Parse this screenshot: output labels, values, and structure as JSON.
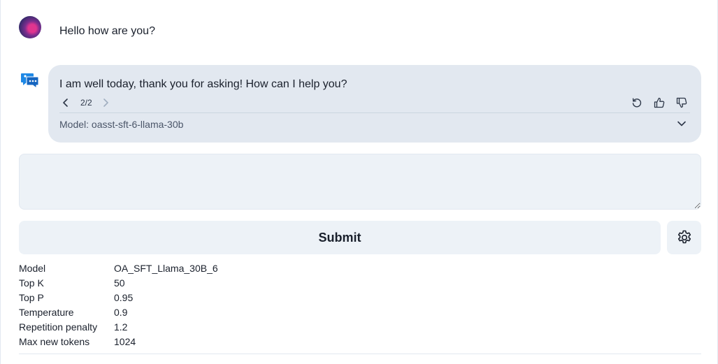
{
  "conversation": {
    "user_message": "Hello how are you?",
    "assistant_message": "I am well today, thank you for asking! How can I help you?",
    "pager": "2/2",
    "model_label": "Model: ",
    "model_value": "oasst-sft-6-llama-30b"
  },
  "input": {
    "value": "",
    "placeholder": ""
  },
  "buttons": {
    "submit_label": "Submit"
  },
  "params": [
    {
      "key": "Model",
      "value": "OA_SFT_Llama_30B_6"
    },
    {
      "key": "Top K",
      "value": "50"
    },
    {
      "key": "Top P",
      "value": "0.95"
    },
    {
      "key": "Temperature",
      "value": "0.9"
    },
    {
      "key": "Repetition penalty",
      "value": "1.2"
    },
    {
      "key": "Max new tokens",
      "value": "1024"
    }
  ],
  "colors": {
    "bubble": "#e2e8f0",
    "input_bg": "#edf2f7",
    "bot_icon": "#1e88e5"
  },
  "icons": [
    "user-avatar",
    "assistant-chat-icon",
    "chevron-left-icon",
    "chevron-right-icon",
    "retry-icon",
    "thumbs-up-icon",
    "thumbs-down-icon",
    "chevron-down-icon",
    "gear-icon"
  ]
}
